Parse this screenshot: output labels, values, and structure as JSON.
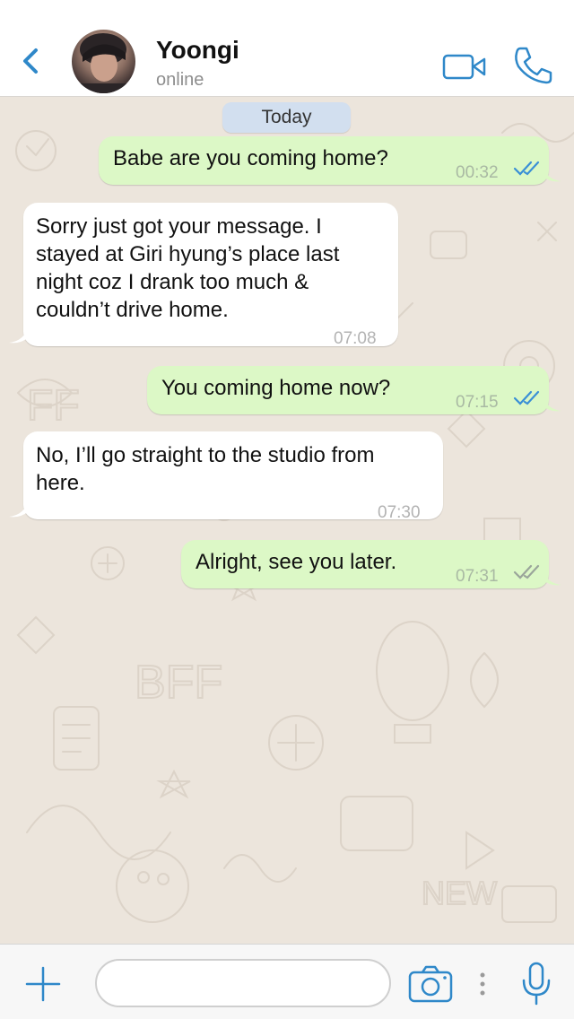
{
  "header": {
    "contact_name": "Yoongi",
    "status": "online",
    "icons": [
      "back-chevron-icon",
      "video-camera-icon",
      "phone-icon"
    ]
  },
  "chat": {
    "date_label": "Today",
    "messages": [
      {
        "direction": "out",
        "text": "Babe are you coming home?",
        "time": "00:32",
        "status": "read"
      },
      {
        "direction": "in",
        "lines": [
          "Sorry just got your message. I",
          "stayed at Giri hyung’s place last",
          "night coz I drank too much &",
          "couldn’t drive home."
        ],
        "time": "07:08"
      },
      {
        "direction": "out",
        "text": "You coming home now?",
        "time": "07:15",
        "status": "read"
      },
      {
        "direction": "in",
        "lines": [
          "No, I’ll go straight to the studio from",
          "here."
        ],
        "time": "07:30"
      },
      {
        "direction": "out",
        "text": "Alright, see you later.",
        "time": "07:31",
        "status": "delivered"
      }
    ]
  },
  "inputbar": {
    "message_value": "",
    "icons": [
      "plus-icon",
      "camera-icon",
      "more-dots-icon",
      "microphone-icon"
    ]
  },
  "colors": {
    "accent": "#2f88c9",
    "outgoing_bubble": "#dcf8c6",
    "incoming_bubble": "#ffffff",
    "chat_background": "#ece5dc",
    "read_ticks": "#3a8fd6",
    "delivered_ticks": "#9aa59a"
  }
}
